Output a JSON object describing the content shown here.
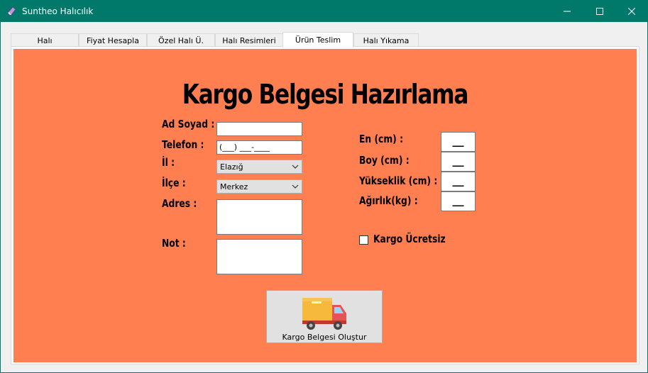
{
  "window": {
    "title": "Suntheo Halıcılık",
    "minimize_glyph": "—",
    "maximize_glyph": "☐",
    "close_glyph": "✕"
  },
  "tabs": [
    {
      "label": "Halı"
    },
    {
      "label": "Fiyat Hesapla"
    },
    {
      "label": "Özel Halı Ü."
    },
    {
      "label": "Halı Resimleri"
    },
    {
      "label": "Ürün Teslim",
      "active": true
    },
    {
      "label": "Halı Yıkama"
    }
  ],
  "form": {
    "heading": "Kargo Belgesi Hazırlama",
    "ad_soyad_label": "Ad Soyad :",
    "ad_soyad_value": "",
    "telefon_label": "Telefon :",
    "telefon_value": "(___) ___-____",
    "il_label": "İl :",
    "il_value": "Elazığ",
    "ilce_label": "İlçe :",
    "ilce_value": "Merkez",
    "adres_label": "Adres :",
    "not_label": "Not :",
    "en_label": "En (cm) :",
    "en_value": "__",
    "boy_label": "Boy (cm) :",
    "boy_value": "__",
    "yukseklik_label": "Yükseklik (cm) :",
    "yukseklik_value": "__",
    "agirlik_label": "Ağırlık(kg) :",
    "agirlik_value": "__",
    "kargo_ucretsiz_label": "Kargo Ücretsiz",
    "kargo_ucretsiz_checked": false,
    "submit_label": "Kargo Belgesi Oluştur"
  },
  "colors": {
    "titlebar": "#00796b",
    "panel": "#ff7f50"
  },
  "icons": {
    "app": "eraser-icon",
    "submit": "delivery-truck-icon"
  }
}
